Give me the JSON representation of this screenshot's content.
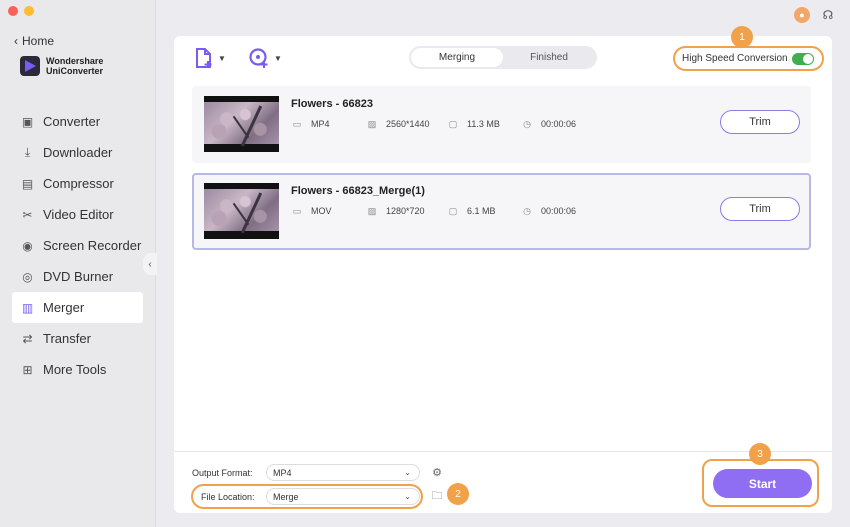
{
  "sidebar": {
    "home_label": "Home",
    "brand_line1": "Wondershare",
    "brand_line2": "UniConverter",
    "items": [
      {
        "label": "Converter",
        "icon": "converter-icon"
      },
      {
        "label": "Downloader",
        "icon": "downloader-icon"
      },
      {
        "label": "Compressor",
        "icon": "compressor-icon"
      },
      {
        "label": "Video Editor",
        "icon": "scissors-icon"
      },
      {
        "label": "Screen Recorder",
        "icon": "screen-recorder-icon"
      },
      {
        "label": "DVD Burner",
        "icon": "dvd-icon"
      },
      {
        "label": "Merger",
        "icon": "merger-icon",
        "active": true
      },
      {
        "label": "Transfer",
        "icon": "transfer-icon"
      },
      {
        "label": "More Tools",
        "icon": "grid-icon"
      }
    ]
  },
  "tabs": {
    "merging": "Merging",
    "finished": "Finished",
    "active": "Merging"
  },
  "high_speed": {
    "label": "High Speed Conversion",
    "enabled": true
  },
  "callouts": [
    "1",
    "2",
    "3"
  ],
  "files": [
    {
      "name": "Flowers - 66823",
      "format": "MP4",
      "resolution": "2560*1440",
      "size": "11.3 MB",
      "duration": "00:00:06",
      "action": "Trim"
    },
    {
      "name": "Flowers - 66823_Merge(1)",
      "format": "MOV",
      "resolution": "1280*720",
      "size": "6.1 MB",
      "duration": "00:00:06",
      "action": "Trim"
    }
  ],
  "bottom": {
    "output_format_label": "Output Format:",
    "output_format_value": "MP4",
    "file_location_label": "File Location:",
    "file_location_value": "Merge",
    "start_label": "Start"
  },
  "colors": {
    "accent": "#8f6ef3",
    "callout": "#f0a14a",
    "toggle_on": "#3fae4f"
  }
}
